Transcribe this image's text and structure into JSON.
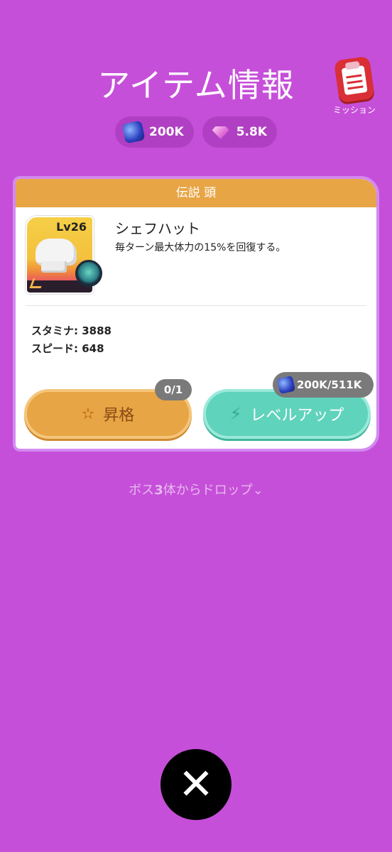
{
  "header": {
    "title": "アイテム情報",
    "mission_label": "ミッション"
  },
  "currency": {
    "cubes": "200K",
    "gems": "5.8K"
  },
  "item": {
    "category": "伝説 頭",
    "level": "Lv26",
    "name": "シェフハット",
    "description": "毎ターン最大体力の15%を回復する。",
    "stats": [
      "スタミナ: 3888",
      "スピード: 648"
    ]
  },
  "actions": {
    "promote_label": "昇格",
    "promote_count": "0/1",
    "levelup_label": "レベルアップ",
    "levelup_cost": "200K/511K"
  },
  "drop": {
    "prefix": "ボス",
    "count": "3",
    "suffix": "体からドロップ",
    "chevron": "⌄"
  },
  "close_glyph": "✕",
  "icons": [
    "checklist-icon",
    "cube-icon",
    "gem-icon",
    "chef-hat-icon",
    "class-icon",
    "pet-badge-icon",
    "stars-icon",
    "bolt-icon",
    "close-icon",
    "chevron-down-icon"
  ],
  "colors": {
    "background": "#c64fd9",
    "legendary": "#e7a545",
    "levelup": "#5fd3bb"
  }
}
